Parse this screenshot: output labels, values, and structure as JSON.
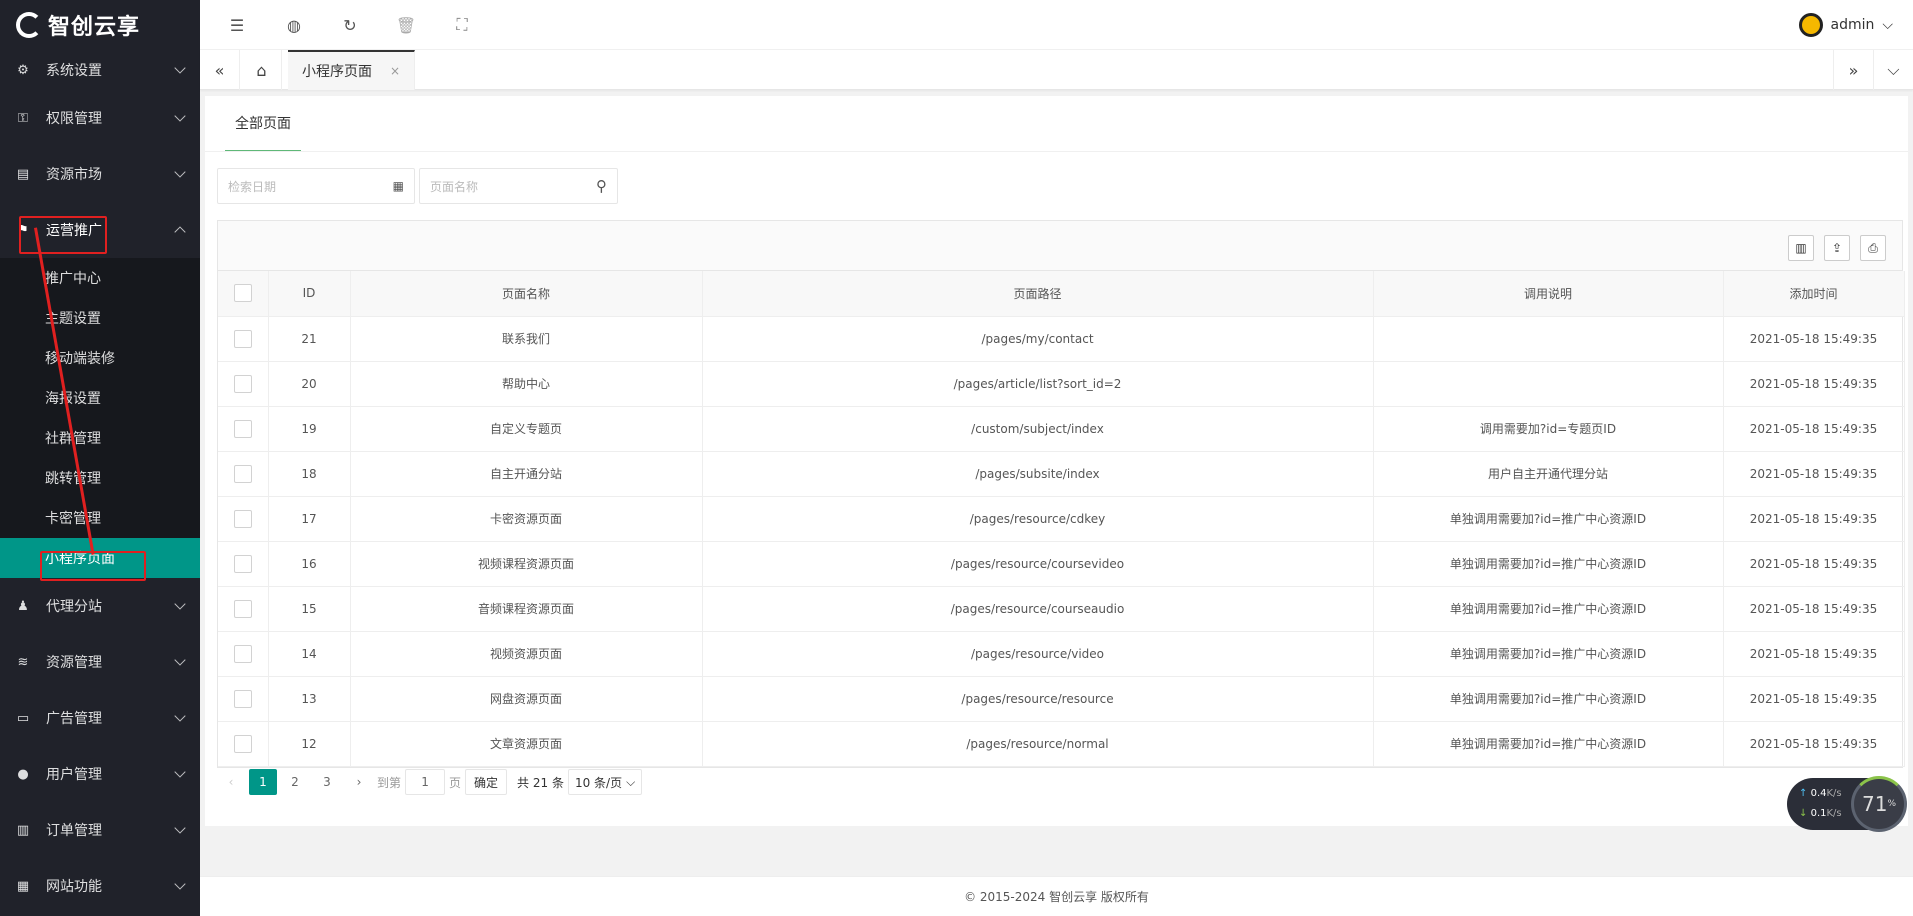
{
  "brand": {
    "name": "智创云享"
  },
  "sidebar": {
    "items": [
      {
        "label": "系统设置",
        "icon": "gear-icon"
      },
      {
        "label": "权限管理",
        "icon": "key-icon"
      },
      {
        "label": "资源市场",
        "icon": "store-icon"
      },
      {
        "label": "运营推广",
        "icon": "flag-icon"
      },
      {
        "label": "代理分站",
        "icon": "user-group-icon"
      },
      {
        "label": "资源管理",
        "icon": "layers-icon"
      },
      {
        "label": "广告管理",
        "icon": "ad-icon"
      },
      {
        "label": "用户管理",
        "icon": "user-icon"
      },
      {
        "label": "订单管理",
        "icon": "list-icon"
      },
      {
        "label": "网站功能",
        "icon": "globe-icon"
      }
    ],
    "submenu": [
      "推广中心",
      "主题设置",
      "移动端装修",
      "海报设置",
      "社群管理",
      "跳转管理",
      "卡密管理",
      "小程序页面"
    ]
  },
  "topbar": {
    "user": "admin"
  },
  "tabs": {
    "current": "小程序页面",
    "close": "×"
  },
  "page": {
    "tab": "全部页面"
  },
  "filters": {
    "date_placeholder": "检索日期",
    "name_placeholder": "页面名称"
  },
  "table": {
    "headers": [
      "ID",
      "页面名称",
      "页面路径",
      "调用说明",
      "添加时间"
    ],
    "rows": [
      [
        "21",
        "联系我们",
        "/pages/my/contact",
        "",
        "2021-05-18 15:49:35"
      ],
      [
        "20",
        "帮助中心",
        "/pages/article/list?sort_id=2",
        "",
        "2021-05-18 15:49:35"
      ],
      [
        "19",
        "自定义专题页",
        "/custom/subject/index",
        "调用需要加?id=专题页ID",
        "2021-05-18 15:49:35"
      ],
      [
        "18",
        "自主开通分站",
        "/pages/subsite/index",
        "用户自主开通代理分站",
        "2021-05-18 15:49:35"
      ],
      [
        "17",
        "卡密资源页面",
        "/pages/resource/cdkey",
        "单独调用需要加?id=推广中心资源ID",
        "2021-05-18 15:49:35"
      ],
      [
        "16",
        "视频课程资源页面",
        "/pages/resource/coursevideo",
        "单独调用需要加?id=推广中心资源ID",
        "2021-05-18 15:49:35"
      ],
      [
        "15",
        "音频课程资源页面",
        "/pages/resource/courseaudio",
        "单独调用需要加?id=推广中心资源ID",
        "2021-05-18 15:49:35"
      ],
      [
        "14",
        "视频资源页面",
        "/pages/resource/video",
        "单独调用需要加?id=推广中心资源ID",
        "2021-05-18 15:49:35"
      ],
      [
        "13",
        "网盘资源页面",
        "/pages/resource/resource",
        "单独调用需要加?id=推广中心资源ID",
        "2021-05-18 15:49:35"
      ],
      [
        "12",
        "文章资源页面",
        "/pages/resource/normal",
        "单独调用需要加?id=推广中心资源ID",
        "2021-05-18 15:49:35"
      ]
    ]
  },
  "pager": {
    "pages": [
      "1",
      "2",
      "3"
    ],
    "goto_prefix": "到第",
    "goto_value": "1",
    "goto_suffix": "页",
    "confirm": "确定",
    "total": "共 21 条",
    "per_page": "10 条/页"
  },
  "footer": {
    "text": "© 2015-2024 智创云享 版权所有"
  },
  "speed": {
    "up": "0.4",
    "down": "0.1",
    "unit": "K/s",
    "percent": "71",
    "percent_unit": "%"
  },
  "colors": {
    "accent": "#009688",
    "sidebar": "#20222a",
    "highlight": "#e02020"
  }
}
